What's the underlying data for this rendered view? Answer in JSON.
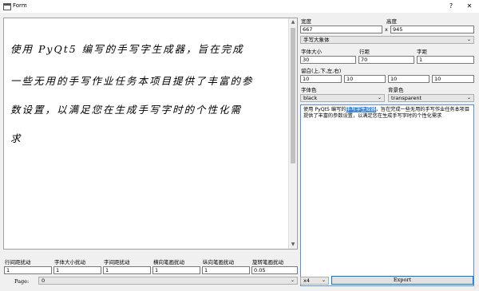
{
  "window": {
    "title": "Form",
    "help": "?",
    "close": "✕"
  },
  "preview": {
    "lines": [
      "使用  PyQt5  编写的手写字生成器，旨在完成",
      "一些无用的手写作业任务本项目提供了丰富的参",
      "数设置，以满足您在生成手写字时的个性化需",
      "求"
    ]
  },
  "settings": {
    "width_label": "宽度",
    "width_value": "667",
    "x_label": "x",
    "height_label": "高度",
    "height_value": "945",
    "font_value": "手写大象体",
    "font_size_label": "字体大小",
    "font_size_value": "30",
    "line_spacing_label": "行距",
    "line_spacing_value": "70",
    "char_spacing_label": "字距",
    "char_spacing_value": "1",
    "margins_label": "留白(上,下,左,右)",
    "margin_top": "10",
    "margin_bottom": "10",
    "margin_left": "10",
    "margin_right": "10",
    "font_color_label": "字体色",
    "font_color_value": "black",
    "bg_color_label": "背景色",
    "bg_color_value": "transparent"
  },
  "text_input": {
    "before": "使用 PyQt5 编写的",
    "highlight": "手写字生成器",
    "after": "，旨在完成一些无用的手写作业任务本项目提供了丰富的参数设置，以满足您在生成手写字时的个性化需求"
  },
  "perturb": {
    "labels": [
      "行间距扰动",
      "字体大小扰动",
      "字间距扰动",
      "横向笔画扰动",
      "纵向笔画扰动",
      "旋转笔画扰动"
    ],
    "values": [
      "1",
      "1",
      "1",
      "1",
      "1",
      "0.05"
    ]
  },
  "footer": {
    "page_label": "Page:",
    "page_value": "0",
    "scale_value": "x4",
    "export_label": "Export"
  }
}
